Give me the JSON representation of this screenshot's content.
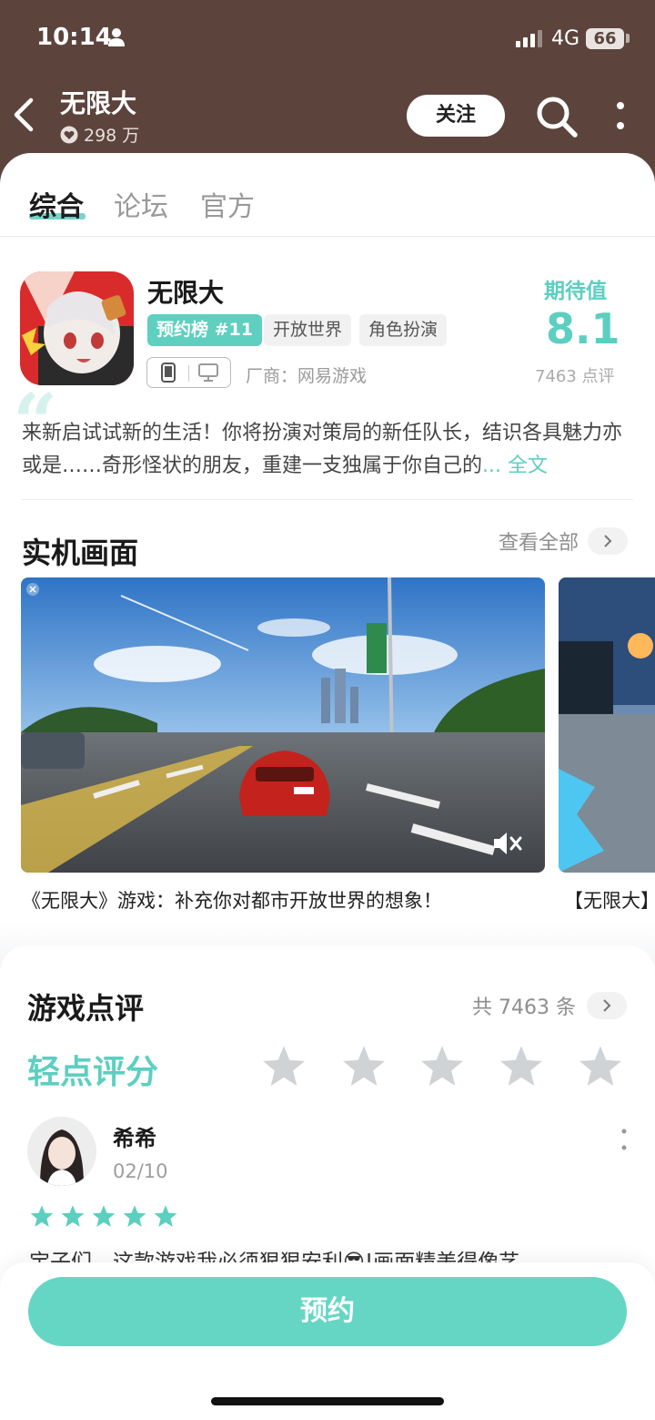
{
  "status_bar": {
    "time": "10:14",
    "network": "4G",
    "battery": "66"
  },
  "header": {
    "title": "无限大",
    "followers": "298 万",
    "follow_label": "关注"
  },
  "tabs": [
    {
      "label": "综合",
      "active": true
    },
    {
      "label": "论坛",
      "active": false
    },
    {
      "label": "官方",
      "active": false
    }
  ],
  "game": {
    "name": "无限大",
    "tags": [
      "预约榜 #11",
      "开放世界",
      "角色扮演"
    ],
    "developer": "厂商：网易游戏",
    "expect_label": "期待值",
    "expect_score": "8.1",
    "review_count": "7463 点评",
    "description": "来新启试试新的生活！你将扮演对策局的新任队长，结识各具魅力亦或是……奇形怪状的朋友，重建一支独属于你自己的",
    "more_label": "... 全文"
  },
  "screenshots": {
    "title": "实机画面",
    "view_all": "查看全部",
    "captions": [
      "《无限大》游戏：补充你对都市开放世界的想象！",
      "【无限大】"
    ]
  },
  "reviews": {
    "title": "游戏点评",
    "total": "共 7463 条",
    "tap_rate": "轻点评分",
    "user_rating_stars": 0,
    "items": [
      {
        "name": "希希",
        "date": "02/10",
        "stars": 5,
        "text": "宝子们，这款游戏我必须狠狠安利😎!画面精美得像艺"
      }
    ]
  },
  "bottom": {
    "reserve_label": "预约"
  },
  "colors": {
    "accent": "#5ccfc0",
    "header_bg": "#5c443d",
    "button": "#66d6c4"
  }
}
